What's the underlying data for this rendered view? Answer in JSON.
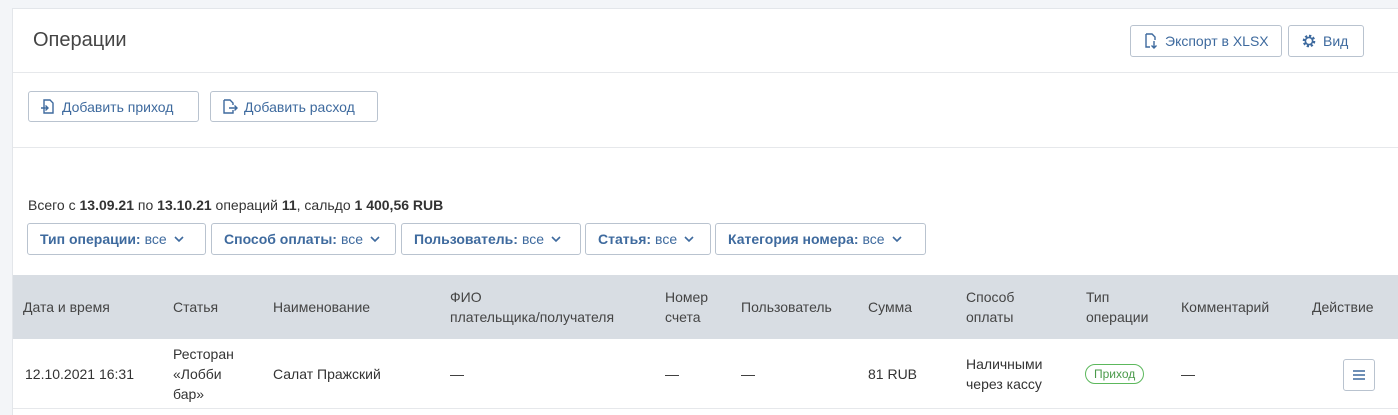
{
  "header": {
    "title": "Операции",
    "export_label": "Экспорт в XLSX",
    "view_label": "Вид"
  },
  "toolbar": {
    "add_income_label": "Добавить приход",
    "add_expense_label": "Добавить расход"
  },
  "summary": {
    "prefix": "Всего с",
    "date_from": "13.09.21",
    "mid": "по",
    "date_to": "13.10.21",
    "ops_label": "операций",
    "ops_count": "11",
    "balance_label": ", сальдо",
    "balance": "1 400,56 RUB"
  },
  "filters": [
    {
      "label": "Тип операции:",
      "value": "все"
    },
    {
      "label": "Способ оплаты:",
      "value": "все"
    },
    {
      "label": "Пользователь:",
      "value": "все"
    },
    {
      "label": "Статья:",
      "value": "все"
    },
    {
      "label": "Категория номера:",
      "value": "все"
    }
  ],
  "table": {
    "columns": {
      "datetime": "Дата и время",
      "article": "Статья",
      "name": "Наименование",
      "payer_l1": "ФИО",
      "payer_l2": "плательщика/получателя",
      "account_l1": "Номер",
      "account_l2": "счета",
      "user": "Пользователь",
      "amount": "Сумма",
      "method_l1": "Способ",
      "method_l2": "оплаты",
      "optype_l1": "Тип",
      "optype_l2": "операции",
      "comment": "Комментарий",
      "action": "Действие"
    },
    "rows": [
      {
        "datetime": "12.10.2021 16:31",
        "article_l1": "Ресторан",
        "article_l2": "«Лобби",
        "article_l3": "бар»",
        "name": "Салат Пражский",
        "payer": "—",
        "account": "—",
        "user": "—",
        "amount": "81 RUB",
        "method_l1": "Наличными",
        "method_l2": "через кассу",
        "optype": "Приход",
        "comment": "—"
      }
    ]
  },
  "colors": {
    "accent": "#3e6a9e",
    "header_bg": "#d8dde3",
    "income_badge": "#5cb85c"
  },
  "icons": {
    "export": "file-download-icon",
    "view": "gear-icon",
    "income": "file-in-icon",
    "expense": "file-out-icon",
    "chevron": "chevron-down-icon",
    "menu": "hamburger-menu-icon"
  }
}
